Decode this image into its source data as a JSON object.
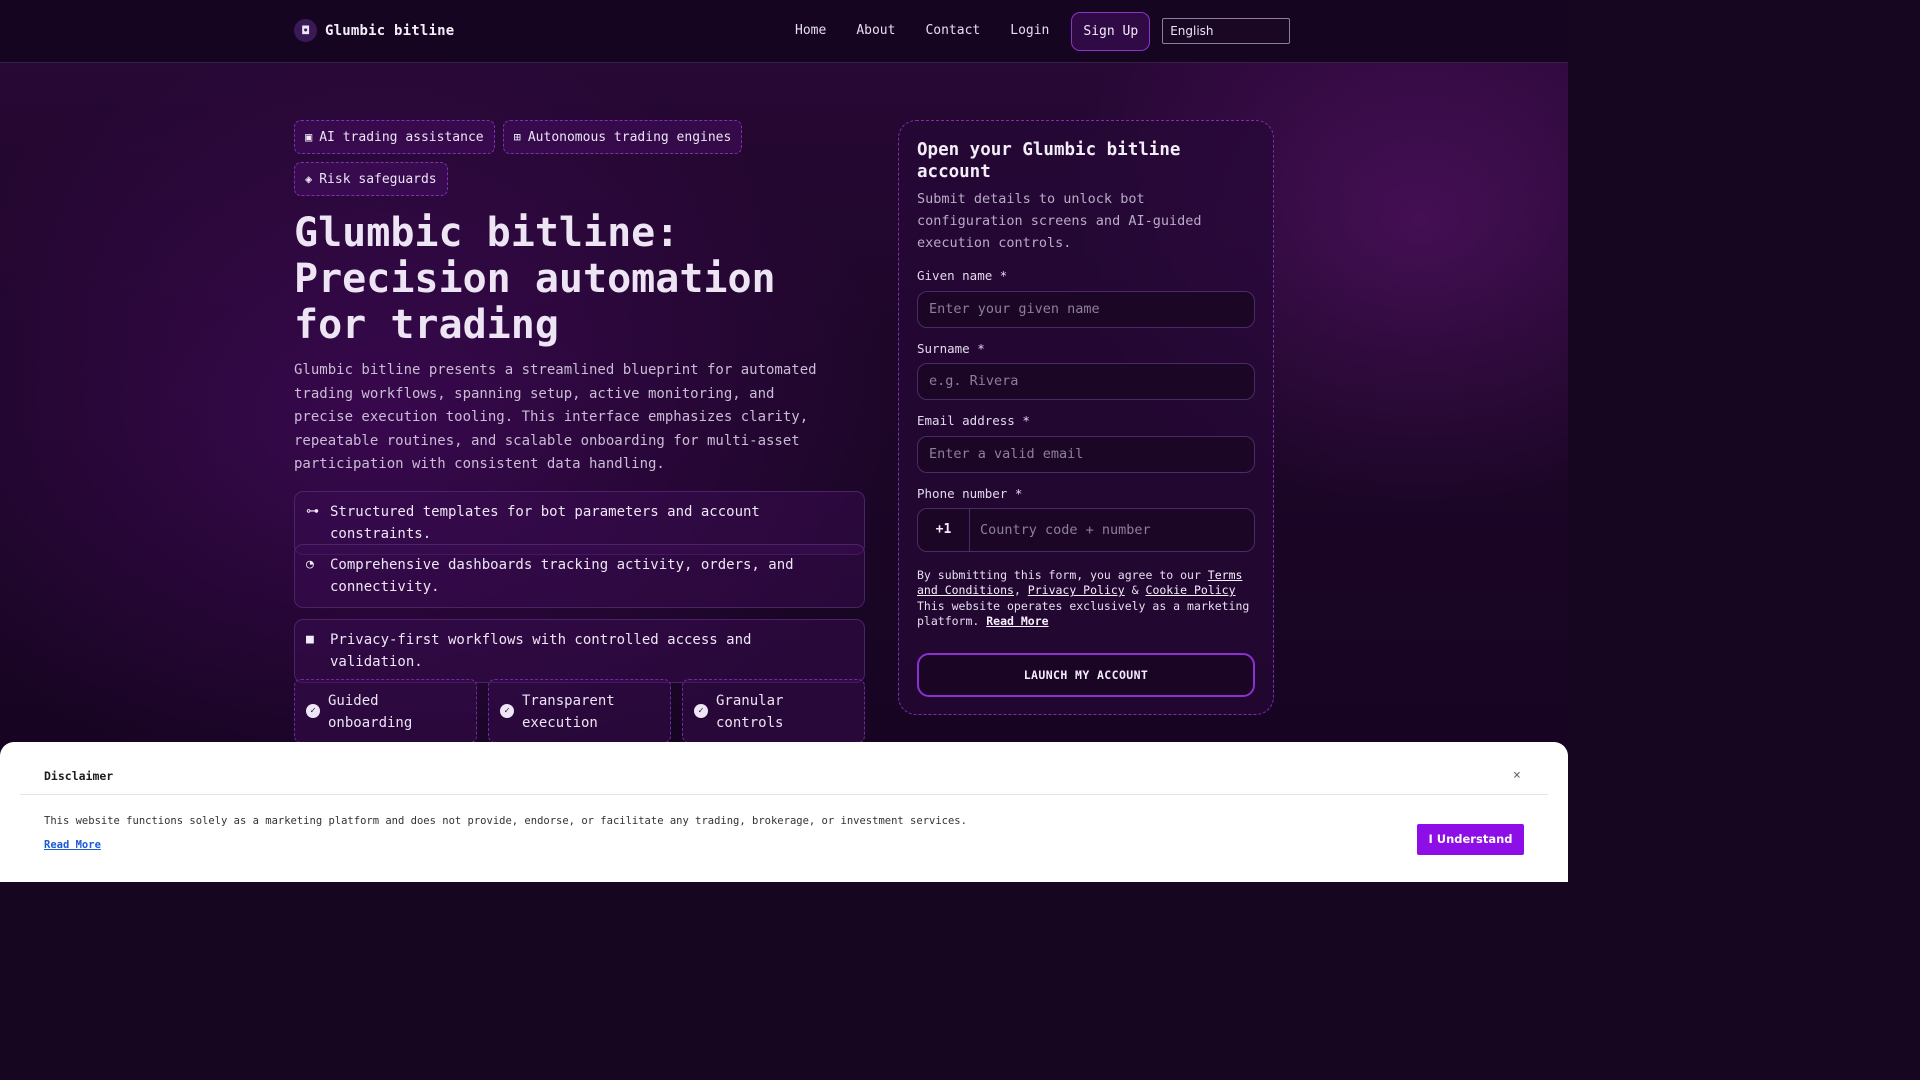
{
  "brand": {
    "name": "Glumbic bitline",
    "logo_icon": "shield-logo-icon"
  },
  "nav": {
    "items": [
      "Home",
      "About",
      "Contact",
      "Login"
    ],
    "signup": "Sign Up",
    "language": "English"
  },
  "hero": {
    "chips": [
      {
        "icon": "chip-cpu-icon",
        "label": "AI trading assistance"
      },
      {
        "icon": "robot-icon",
        "label": "Autonomous trading engines"
      },
      {
        "icon": "shield-icon",
        "label": "Risk safeguards"
      }
    ],
    "title": "Glumbic bitline: Precision automation for trading",
    "description": "Glumbic bitline presents a streamlined blueprint for automated trading workflows, spanning setup, active monitoring, and precise execution tooling. This interface emphasizes clarity, repeatable routines, and scalable onboarding for multi-asset participation with consistent data handling.",
    "features": [
      {
        "icon": "network-icon",
        "text": "Structured templates for bot parameters and account constraints."
      },
      {
        "icon": "dashboard-gauge-icon",
        "text": "Comprehensive dashboards tracking activity, orders, and connectivity."
      },
      {
        "icon": "lock-icon",
        "text": "Privacy-first workflows with controlled access and validation."
      }
    ],
    "highlights": [
      "Guided onboarding",
      "Transparent execution",
      "Granular controls"
    ]
  },
  "form": {
    "title": "Open your Glumbic bitline account",
    "subtitle": "Submit details to unlock bot configuration screens and AI-guided execution controls.",
    "given_name": {
      "label": "Given name *",
      "placeholder": "Enter your given name"
    },
    "surname": {
      "label": "Surname *",
      "placeholder": "e.g. Rivera"
    },
    "email": {
      "label": "Email address *",
      "placeholder": "Enter a valid email"
    },
    "phone": {
      "label": "Phone number *",
      "code": "+1",
      "placeholder": "Country code + number"
    },
    "terms": {
      "prefix": "By submitting this form, you agree to our ",
      "terms_link": "Terms and Conditions",
      "comma": ", ",
      "privacy_link": "Privacy Policy",
      "amp": " & ",
      "cookie_link": "Cookie Policy",
      "suffix": " This website operates exclusively as a marketing platform. ",
      "read_more": "Read More"
    },
    "submit": "LAUNCH MY ACCOUNT"
  },
  "disclaimer": {
    "title": "Disclaimer",
    "close": "×",
    "text": "This website functions solely as a marketing platform and does not provide, endorse, or facilitate any trading, brokerage, or investment services.",
    "read_more": "Read More",
    "button": "I Understand"
  },
  "colors": {
    "background": "#170620",
    "accent": "#8d0ee6",
    "card_border": "#7a2fae",
    "disclaimer_bg": "#ffffff"
  }
}
